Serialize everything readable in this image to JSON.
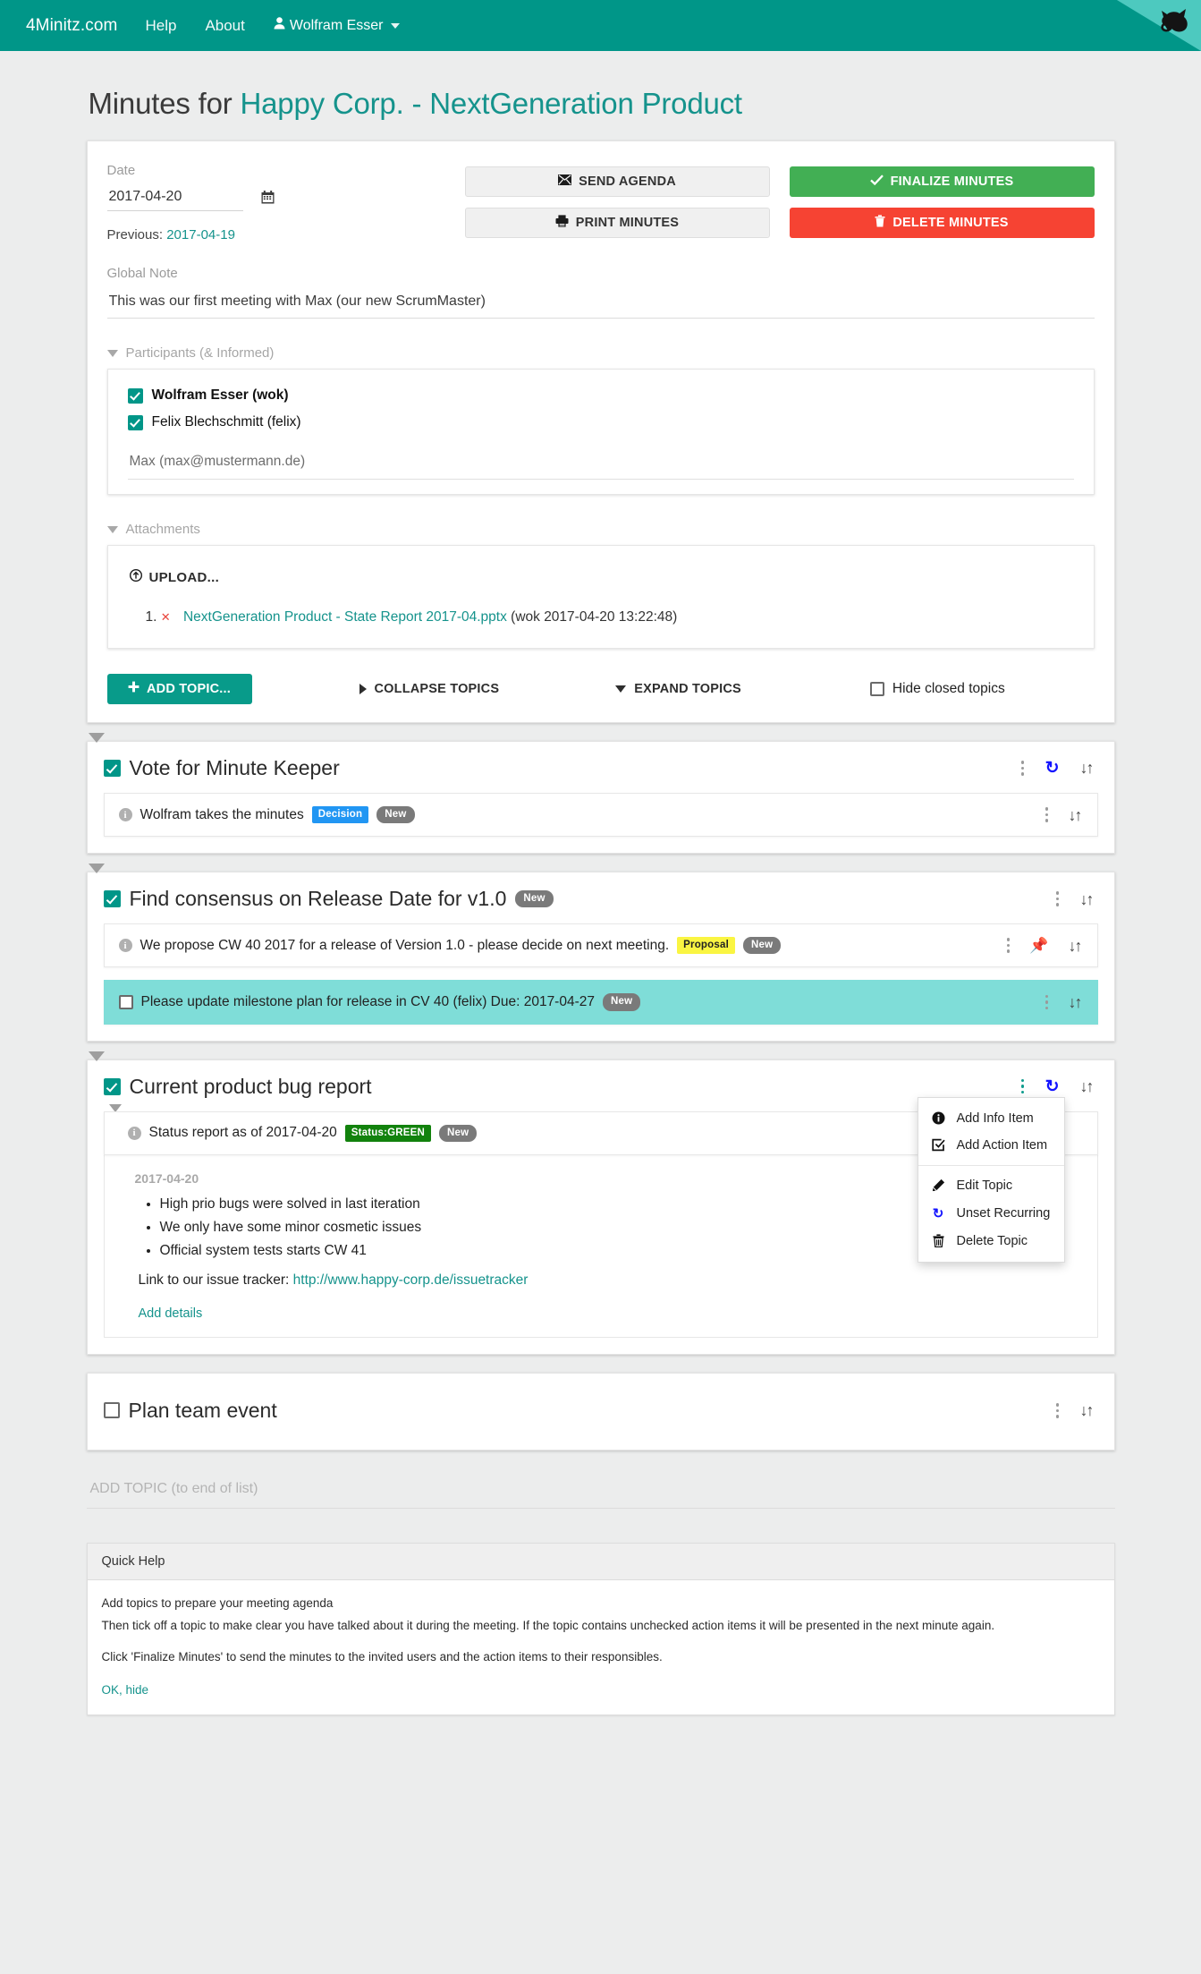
{
  "navbar": {
    "brand": "4Minitz.com",
    "links": [
      {
        "label": "Help"
      },
      {
        "label": "About"
      }
    ],
    "user": "Wolfram Esser",
    "user_icon": "person-icon",
    "ribbon_icon": "cat-silhouette-icon",
    "brand_color": "#009688",
    "ribbon_color": "#4dc9bf"
  },
  "page": {
    "title_prefix": "Minutes for ",
    "title_accent": "Happy Corp. - NextGeneration Product"
  },
  "header_card": {
    "date_label": "Date",
    "date_value": "2017-04-20",
    "calendar_icon": "calendar-icon",
    "previous_label": "Previous: ",
    "previous_date": "2017-04-19",
    "buttons": {
      "send_agenda": "SEND AGENDA",
      "send_agenda_icon": "envelope-icon",
      "print_minutes": "PRINT MINUTES",
      "print_minutes_icon": "printer-icon",
      "finalize_minutes": "FINALIZE MINUTES",
      "finalize_icon": "check-icon",
      "delete_minutes": "DELETE MINUTES",
      "delete_icon": "trash-icon"
    },
    "global_note_label": "Global Note",
    "global_note_value": "This was our first meeting with Max (our new ScrumMaster)",
    "participants_label": "Participants (& Informed)",
    "participants": [
      {
        "name": "Wolfram Esser (wok)",
        "checked": true,
        "bold": true
      },
      {
        "name": "Felix Blechschmitt (felix)",
        "checked": true,
        "bold": false
      }
    ],
    "informed_value": "Max (max@mustermann.de)",
    "attachments_label": "Attachments",
    "upload_label": "UPLOAD...",
    "upload_icon": "upload-circle-icon",
    "attachments": [
      {
        "index": "1.",
        "remove_icon": "x-icon",
        "filename": "NextGeneration Product - State Report 2017-04.pptx",
        "meta": "(wok 2017-04-20 13:22:48)"
      }
    ],
    "add_topic_label": "ADD TOPIC...",
    "add_topic_icon": "plus-icon",
    "collapse_label": "COLLAPSE TOPICS",
    "collapse_icon": "triangle-right-icon",
    "expand_label": "EXPAND TOPICS",
    "expand_icon": "triangle-down-icon",
    "hide_closed_label": "Hide closed topics",
    "hide_closed_checked": false
  },
  "topics": [
    {
      "title": "Vote for Minute Keeper",
      "checked": true,
      "badges": [],
      "icons": [
        "kebab-menu-icon",
        "recurring-icon",
        "sort-icon"
      ],
      "items": [
        {
          "text": "Wolfram takes the minutes",
          "type": "info",
          "icon": "info-icon",
          "badges": [
            {
              "label": "Decision",
              "style": "decision"
            },
            {
              "label": "New",
              "style": "new"
            }
          ],
          "icons": [
            "kebab-menu-icon",
            "sort-icon"
          ],
          "highlight": false
        }
      ]
    },
    {
      "title": "Find consensus on Release Date for v1.0",
      "checked": true,
      "badges": [
        {
          "label": "New",
          "style": "new"
        }
      ],
      "icons": [
        "kebab-menu-icon",
        "sort-icon"
      ],
      "items": [
        {
          "text": "We propose CW 40 2017 for a release of Version 1.0 - please decide on next meeting.",
          "type": "info",
          "icon": "info-icon",
          "badges": [
            {
              "label": "Proposal",
              "style": "proposal"
            },
            {
              "label": "New",
              "style": "new"
            }
          ],
          "icons": [
            "kebab-menu-icon",
            "pin-icon",
            "sort-icon"
          ],
          "highlight": false
        },
        {
          "text": "Please update milestone plan for release in CV 40 (felix) Due: 2017-04-27",
          "type": "action",
          "icon": "checkbox-empty-icon",
          "badges": [
            {
              "label": "New",
              "style": "new"
            }
          ],
          "icons": [
            "kebab-menu-icon",
            "sort-icon"
          ],
          "highlight": true
        }
      ]
    },
    {
      "title": "Current product bug report",
      "checked": true,
      "badges": [],
      "icons": [
        "kebab-menu-icon",
        "recurring-icon",
        "sort-icon"
      ],
      "items": [
        {
          "text": "Status report as of 2017-04-20",
          "type": "info",
          "icon": "info-icon",
          "badges": [
            {
              "label": "Status:GREEN",
              "style": "green"
            },
            {
              "label": "New",
              "style": "new"
            }
          ],
          "icons": [],
          "highlight": false
        }
      ],
      "details": {
        "date": "2017-04-20",
        "bullets": [
          "High prio bugs were solved in last iteration",
          "We only have some minor cosmetic issues",
          "Official system tests starts CW 41"
        ],
        "link_prefix": "Link to our issue tracker: ",
        "link_text": "http://www.happy-corp.de/issuetracker",
        "add_details_label": "Add details"
      }
    },
    {
      "title": "Plan team event",
      "checked": false,
      "badges": [],
      "icons": [
        "kebab-menu-icon",
        "sort-icon"
      ],
      "items": []
    }
  ],
  "dropdown_menu": {
    "items": [
      {
        "label": "Add Info Item",
        "icon": "info-icon"
      },
      {
        "label": "Add Action Item",
        "icon": "check-square-icon"
      },
      {
        "separator": true
      },
      {
        "label": "Edit Topic",
        "icon": "pencil-icon"
      },
      {
        "label": "Unset Recurring",
        "icon": "recurring-icon"
      },
      {
        "label": "Delete Topic",
        "icon": "trash-icon"
      }
    ]
  },
  "footer": {
    "add_topic_end": "ADD TOPIC (to end of list)",
    "quick_help_title": "Quick Help",
    "quick_help_lines": [
      "Add topics to prepare your meeting agenda",
      "Then tick off a topic to make clear you have talked about it during the meeting. If the topic contains unchecked action items it will be presented in the next minute again.",
      "Click 'Finalize Minutes' to send the minutes to the invited users and the action items to their responsibles."
    ],
    "ok_hide": "OK, hide"
  }
}
